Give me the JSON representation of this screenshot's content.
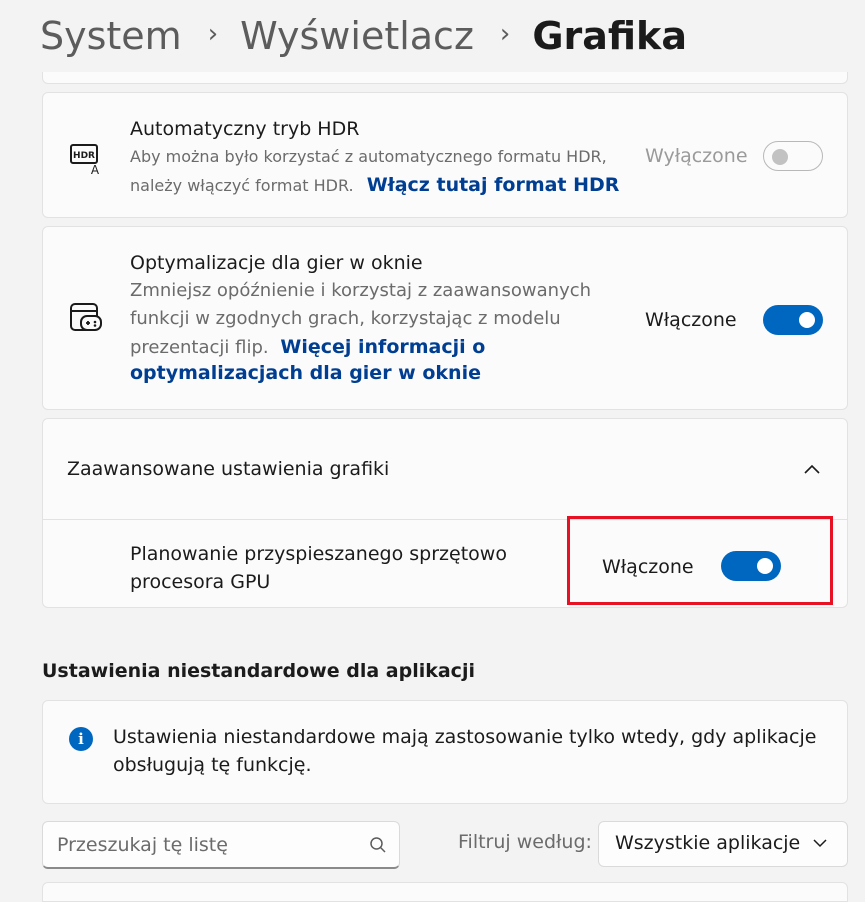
{
  "breadcrumb": {
    "items": [
      "System",
      "Wyświetlacz",
      "Grafika"
    ],
    "separator": "›"
  },
  "auto_hdr": {
    "title": "Automatyczny tryb HDR",
    "desc_line1": "Aby można było korzystać z automatycznego formatu HDR,",
    "desc_line2": "należy włączyć format HDR.",
    "link": "Włącz tutaj format HDR",
    "state": "Wyłączone",
    "enabled": false,
    "icon": "hdr-icon"
  },
  "windowed_games": {
    "title": "Optymalizacje dla gier w oknie",
    "desc_line1": "Zmniejsz opóźnienie i korzystaj z zaawansowanych",
    "desc_line2": "funkcji w zgodnych grach, korzystając z modelu",
    "desc_line3": "prezentacji flip.",
    "link_part1": "Więcej informacji o",
    "link_part2": "optymalizacjach dla gier w oknie",
    "state": "Włączone",
    "enabled": true,
    "icon": "game-window-icon"
  },
  "advanced": {
    "title": "Zaawansowane ustawienia grafiki",
    "gpu_title_line1": "Planowanie przyspieszanego sprzętowo",
    "gpu_title_line2": "procesora GPU",
    "gpu_state": "Włączone",
    "gpu_enabled": true
  },
  "app_settings": {
    "heading": "Ustawienia niestandardowe dla aplikacji",
    "info_line1": "Ustawienia niestandardowe mają zastosowanie tylko wtedy, gdy aplikacje",
    "info_line2": "obsługują tę funkcję.",
    "info_glyph": "i",
    "search_placeholder": "Przeszukaj tę listę",
    "filter_label": "Filtruj według:",
    "filter_value": "Wszystkie aplikacje"
  },
  "colors": {
    "accent": "#0067c0",
    "link": "#003e92",
    "highlight": "#e81123"
  }
}
